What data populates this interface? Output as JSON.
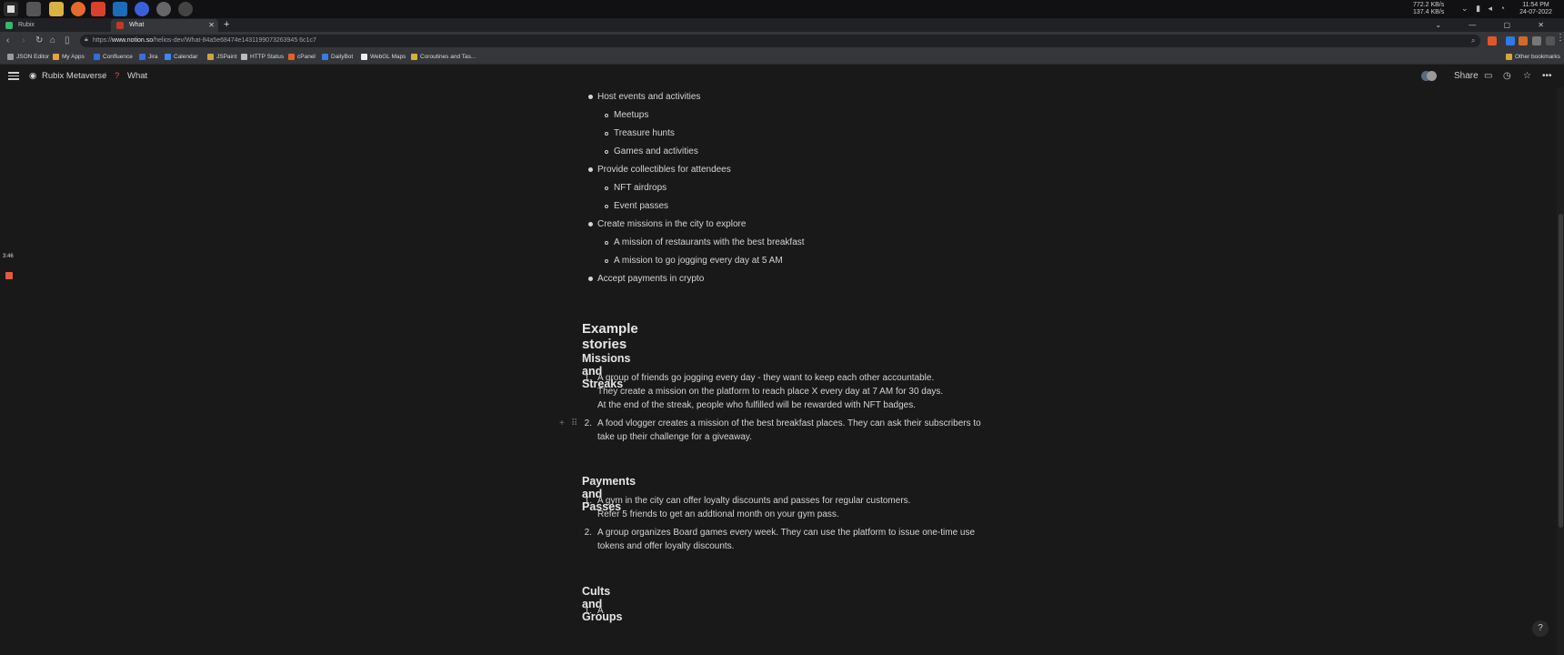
{
  "tray": {
    "net_down": "772.2 KB/s",
    "net_up": "137.4 KB/s",
    "time": "11:54 PM",
    "date": "24-07-2022"
  },
  "browser": {
    "tabs": [
      {
        "label": "Rubix"
      },
      {
        "label": "What"
      }
    ],
    "url_prefix": "https://",
    "url_domain": "www.notion.so",
    "url_path": "/helios-dev/What-84a5e68474e1431199073263945 6c1c7",
    "bookmarks": [
      "JSON Editor",
      "My Apps",
      "Confluence",
      "Jira",
      "Calendar",
      "JSPaint",
      "HTTP Status",
      "cPanel",
      "DailyBot",
      "WebGL Maps",
      "Coroutines and Tas..."
    ],
    "other_bookmarks": "Other bookmarks"
  },
  "notion": {
    "breadcrumb": [
      "Rubix Metaverse",
      "/",
      "What"
    ],
    "share": "Share"
  },
  "overlay": {
    "timer": "3:46"
  },
  "content": {
    "list": [
      {
        "text": "Host events and activities",
        "children": [
          "Meetups",
          "Treasure hunts",
          "Games and activities"
        ]
      },
      {
        "text": "Provide collectibles for attendees",
        "children": [
          "NFT airdrops",
          "Event passes"
        ]
      },
      {
        "text": "Create missions in the city to explore",
        "children": [
          "A mission of restaurants with the best breakfast",
          "A mission to go jogging every day at 5 AM"
        ]
      },
      {
        "text": "Accept payments in crypto",
        "children": []
      }
    ],
    "heading": "Example stories",
    "sections": [
      {
        "title": "Missions and Streaks",
        "items": [
          {
            "num": "1.",
            "lines": [
              "A group of friends go jogging every day - they want to keep each other accountable.",
              "They create a mission on the platform to reach place X every day at 7 AM for 30 days.",
              "At the end of the streak, people who fulfilled will be rewarded with NFT badges."
            ]
          },
          {
            "num": "2.",
            "lines": [
              "A food vlogger creates a mission of the best breakfast places. They can ask their subscribers to",
              "take up their challenge for a giveaway."
            ]
          }
        ]
      },
      {
        "title": "Payments and Passes",
        "items": [
          {
            "num": "1.",
            "lines": [
              "A gym in the city can offer loyalty discounts and passes for regular customers.",
              "Refer 5 friends to get an addtional month on your gym pass."
            ]
          },
          {
            "num": "2.",
            "lines": [
              "A group organizes Board games every week. They can use the platform to issue one-time use",
              "tokens and offer loyalty discounts."
            ]
          }
        ]
      },
      {
        "title": "Cults and Groups",
        "items": [
          {
            "num": "1.",
            "lines": [
              "A"
            ]
          }
        ]
      }
    ]
  }
}
